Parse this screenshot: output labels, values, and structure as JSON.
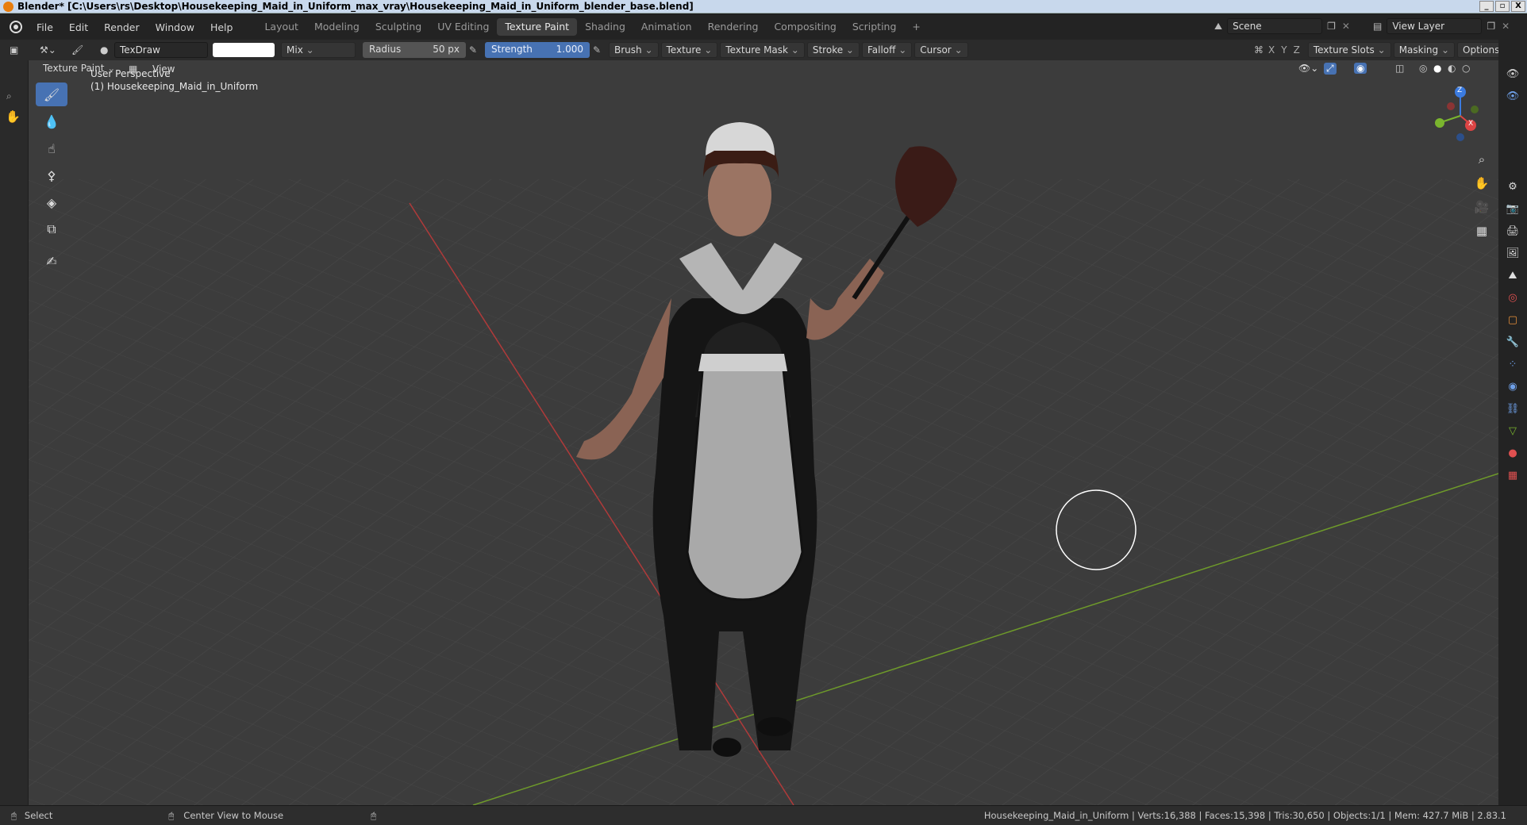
{
  "titlebar": {
    "title": "Blender* [C:\\Users\\rs\\Desktop\\Housekeeping_Maid_in_Uniform_max_vray\\Housekeeping_Maid_in_Uniform_blender_base.blend]",
    "buttons": [
      "_",
      "▫",
      "X"
    ]
  },
  "menubar": {
    "menus": [
      "File",
      "Edit",
      "Render",
      "Window",
      "Help"
    ],
    "workspaces": [
      "Layout",
      "Modeling",
      "Sculpting",
      "UV Editing",
      "Texture Paint",
      "Shading",
      "Animation",
      "Rendering",
      "Compositing",
      "Scripting"
    ],
    "active_workspace": "Texture Paint",
    "add_tab": "+",
    "scene": "Scene",
    "view_layer": "View Layer"
  },
  "toolheader": {
    "brush_name": "TexDraw",
    "blend_mode": "Mix",
    "radius_label": "Radius",
    "radius_value": "50 px",
    "strength_label": "Strength",
    "strength_value": "1.000",
    "menus": [
      "Brush",
      "Texture",
      "Texture Mask",
      "Stroke",
      "Falloff",
      "Cursor"
    ],
    "axes": [
      "X",
      "Y",
      "Z"
    ],
    "right_menus": [
      "Texture Slots",
      "Masking",
      "Options"
    ],
    "brush_color": "#ffffff"
  },
  "viewheader": {
    "mode": "Texture Paint",
    "view": "View"
  },
  "viewport": {
    "perspective": "User Perspective",
    "object": "(1) Housekeeping_Maid_in_Uniform",
    "gizmo": {
      "x": "X",
      "y": "Y",
      "z": "Z"
    }
  },
  "toolbar": {
    "tools": [
      "draw-tool",
      "soften-tool",
      "smear-tool",
      "clone-tool",
      "fill-tool",
      "mask-tool",
      "annotate-tool"
    ],
    "active": "draw-tool"
  },
  "statusbar": {
    "select": "Select",
    "center_view": "Center View to Mouse",
    "stats": "Housekeeping_Maid_in_Uniform | Verts:16,388 | Faces:15,398 | Tris:30,650 | Objects:1/1 | Mem: 427.7 MiB | 2.83.1"
  },
  "colors": {
    "accent": "#4772b3",
    "x_axis": "#c83a3a",
    "y_axis": "#6e9a2a"
  }
}
